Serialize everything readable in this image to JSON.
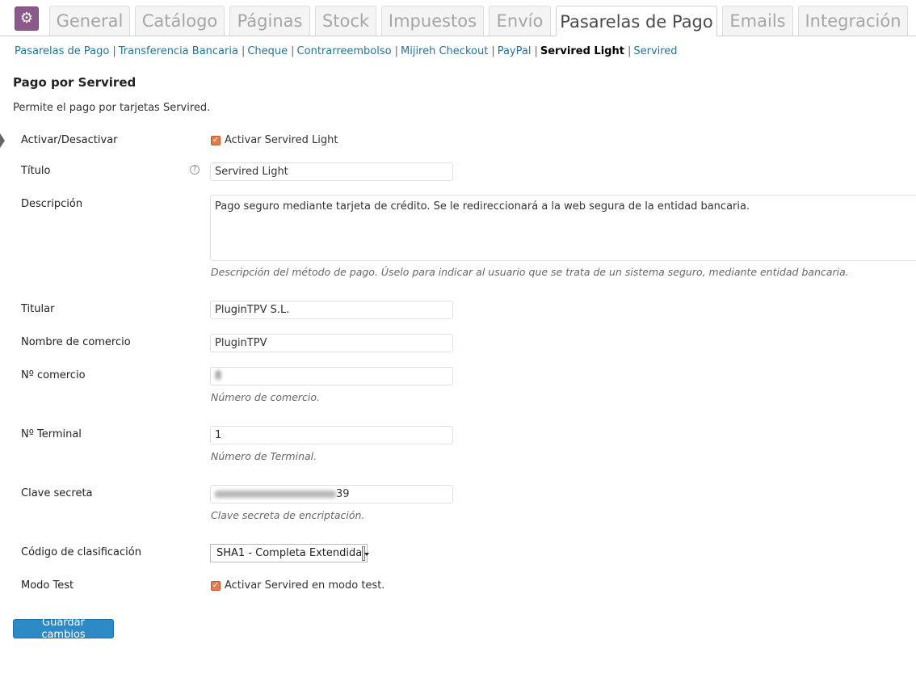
{
  "tabs": [
    {
      "label": "General"
    },
    {
      "label": "Catálogo"
    },
    {
      "label": "Páginas"
    },
    {
      "label": "Stock"
    },
    {
      "label": "Impuestos"
    },
    {
      "label": "Envío"
    },
    {
      "label": "Pasarelas de Pago",
      "active": true
    },
    {
      "label": "Emails"
    },
    {
      "label": "Integración"
    }
  ],
  "subnav": {
    "items": [
      {
        "label": "Pasarelas de Pago"
      },
      {
        "label": "Transferencia Bancaria"
      },
      {
        "label": "Cheque"
      },
      {
        "label": "Contrarreembolso"
      },
      {
        "label": "Mijireh Checkout"
      },
      {
        "label": "PayPal"
      },
      {
        "label": "Servired Light",
        "current": true
      },
      {
        "label": "Servired"
      }
    ],
    "separator": "|"
  },
  "section": {
    "title": "Pago por Servired",
    "description": "Permite el pago por tarjetas Servired."
  },
  "form": {
    "enable": {
      "label": "Activar/Desactivar",
      "checkbox_label": "Activar Servired Light",
      "checked": true
    },
    "title": {
      "label": "Título",
      "value": "Servired Light"
    },
    "description": {
      "label": "Descripción",
      "value": "Pago seguro mediante tarjeta de crédito. Se le redireccionará a la web segura de la entidad bancaria.",
      "hint": "Descripción del método de pago. Úselo para indicar al usuario que se trata de un sistema seguro, mediante entidad bancaria."
    },
    "holder": {
      "label": "Titular",
      "value": "PluginTPV S.L."
    },
    "merchant_name": {
      "label": "Nombre de comercio",
      "value": "PluginTPV"
    },
    "merchant_number": {
      "label": "Nº comercio",
      "value": "8",
      "hint": "Número de comercio."
    },
    "terminal": {
      "label": "Nº Terminal",
      "value": "1",
      "hint": "Número de Terminal."
    },
    "secret_key": {
      "label": "Clave secreta",
      "value_suffix": "39",
      "hint": "Clave secreta de encriptación."
    },
    "classification": {
      "label": "Código de clasificación",
      "selected": "SHA1 - Completa Extendida"
    },
    "test_mode": {
      "label": "Modo Test",
      "checkbox_label": "Activar Servired en modo test.",
      "checked": true
    }
  },
  "actions": {
    "save_label": "Guardar cambios"
  },
  "colors": {
    "accent": "#8c5a8a",
    "link": "#21759b",
    "checkbox": "#e57c4b",
    "primary_button": "#2e8ac5"
  }
}
